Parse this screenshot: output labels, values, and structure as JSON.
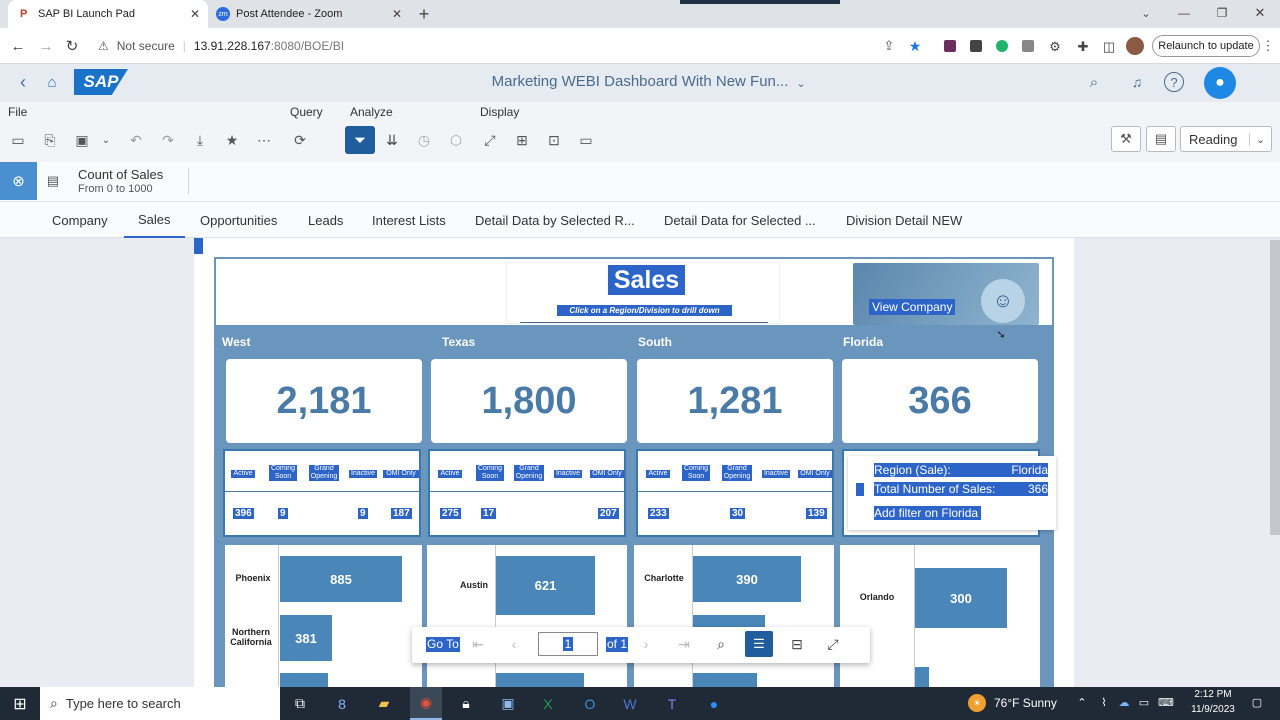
{
  "browser": {
    "tabs": [
      {
        "label": "SAP BI Launch Pad"
      },
      {
        "label": "Post Attendee - Zoom"
      }
    ],
    "url_warning": "Not secure",
    "url_host": "13.91.228.167",
    "url_path": ":8080/BOE/BI",
    "relaunch": "Relaunch to update"
  },
  "sap": {
    "logo": "SAP",
    "title": "Marketing WEBI Dashboard With New Fun...",
    "menu": {
      "file": "File",
      "query": "Query",
      "analyze": "Analyze",
      "display": "Display"
    },
    "mode": "Reading"
  },
  "filter": {
    "title": "Count of Sales",
    "range": "From 0 to 1000"
  },
  "report_tabs": [
    "Company",
    "Sales",
    "Opportunities",
    "Leads",
    "Interest Lists",
    "Detail Data by Selected R...",
    "Detail Data for Selected ...",
    "Division Detail NEW"
  ],
  "report": {
    "title": "Sales",
    "subtitle": "Click on a Region/Division to drill down",
    "view_company": "View Company",
    "regions": [
      {
        "name": "West",
        "total": "2,181",
        "counts": [
          "396",
          "9",
          "",
          "9",
          "187"
        ]
      },
      {
        "name": "Texas",
        "total": "1,800",
        "counts": [
          "275",
          "17",
          "",
          "",
          "207"
        ]
      },
      {
        "name": "South",
        "total": "1,281",
        "counts": [
          "233",
          "",
          "30",
          "",
          "139"
        ]
      },
      {
        "name": "Florida",
        "total": "366",
        "counts": []
      }
    ],
    "status_headers": [
      "Active",
      "Coming Soon",
      "Grand Opening",
      "Inactive",
      "OMI Only"
    ],
    "tooltip": {
      "region_label": "Region (Sale):",
      "region_value": "Florida",
      "total_label": "Total Number of Sales:",
      "total_value": "366",
      "action": "Add filter on Florida"
    },
    "cities": [
      {
        "name": "Phoenix",
        "value": "885"
      },
      {
        "name": "Northern California",
        "value": "381"
      },
      {
        "name": "Austin",
        "value": "621"
      },
      {
        "name": "Charlotte",
        "value": "390"
      },
      {
        "name": "Orlando",
        "value": "300"
      }
    ]
  },
  "pager": {
    "goto": "Go To",
    "page": "1",
    "of": "of 1"
  },
  "taskbar": {
    "search": "Type here to search",
    "weather": "76°F  Sunny",
    "time": "2:12 PM",
    "date": "11/9/2023"
  }
}
